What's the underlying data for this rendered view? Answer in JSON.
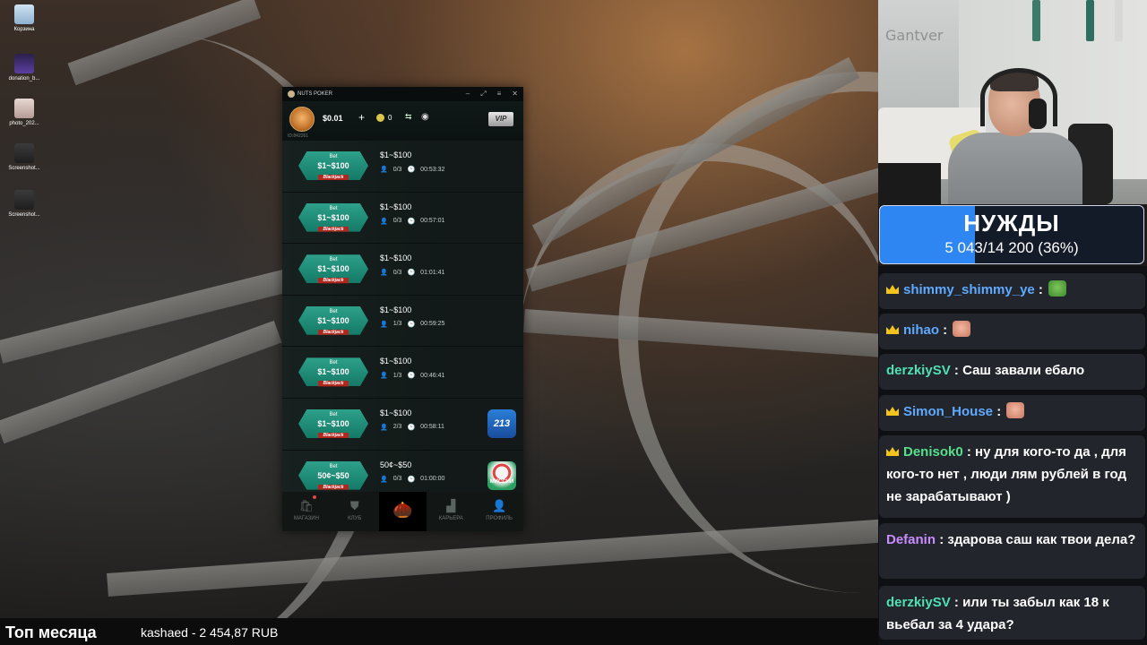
{
  "desktop": {
    "icons": [
      {
        "label": "Корзина",
        "icon": "trash-icon"
      },
      {
        "label": "donation_b...",
        "icon": "file-icon"
      },
      {
        "label": "photo_202...",
        "icon": "image-icon"
      },
      {
        "label": "Screenshot...",
        "icon": "image-icon"
      },
      {
        "label": "Screenshot...",
        "icon": "image-icon"
      }
    ]
  },
  "poker": {
    "title": "NUTS POKER",
    "balance": "$0.01",
    "coins": "0",
    "player_id": "ID:842261",
    "vip_label": "VIP",
    "tables": [
      {
        "bet": "Bet",
        "range": "$1~$100",
        "game": "Blackjack",
        "stakes": "$1~$100",
        "players": "0/3",
        "time": "00:53:32",
        "badge": ""
      },
      {
        "bet": "Bet",
        "range": "$1~$100",
        "game": "Blackjack",
        "stakes": "$1~$100",
        "players": "0/3",
        "time": "00:57:01",
        "badge": ""
      },
      {
        "bet": "Bet",
        "range": "$1~$100",
        "game": "Blackjack",
        "stakes": "$1~$100",
        "players": "0/3",
        "time": "01:01:41",
        "badge": ""
      },
      {
        "bet": "Bet",
        "range": "$1~$100",
        "game": "Blackjack",
        "stakes": "$1~$100",
        "players": "1/3",
        "time": "00:59:25",
        "badge": ""
      },
      {
        "bet": "Bet",
        "range": "$1~$100",
        "game": "Blackjack",
        "stakes": "$1~$100",
        "players": "1/3",
        "time": "00:46:41",
        "badge": ""
      },
      {
        "bet": "Bet",
        "range": "$1~$100",
        "game": "Blackjack",
        "stakes": "$1~$100",
        "players": "2/3",
        "time": "00:58:11",
        "badge": "213"
      },
      {
        "bet": "Bet",
        "range": "50¢~$50",
        "game": "Blackjack",
        "stakes": "50¢~$50",
        "players": "0/3",
        "time": "01:00:00",
        "badge": "МИССИИ"
      }
    ],
    "nav": [
      {
        "label": "МАГАЗИН",
        "icon": "shop-icon"
      },
      {
        "label": "КЛУБ",
        "icon": "club-icon"
      },
      {
        "label": "",
        "icon": "acorn-icon"
      },
      {
        "label": "КАРЬЕРА",
        "icon": "career-icon"
      },
      {
        "label": "ПРОФИЛЬ",
        "icon": "profile-icon"
      }
    ]
  },
  "webcam": {
    "wall_text": "Gantver"
  },
  "goal": {
    "title": "НУЖДЫ",
    "progress_text": "5 043/14 200 (36%)",
    "fraction": 0.36
  },
  "chat": [
    {
      "user": "shimmy_shimmy_ye",
      "text": "",
      "sep": ":",
      "crown": true,
      "emote": "pepe",
      "color": "#5fa9ff"
    },
    {
      "user": "nihao",
      "text": "",
      "sep": ":",
      "crown": true,
      "emote": "face",
      "color": "#5fa9ff"
    },
    {
      "user": "derzkiySV",
      "text": "Саш завали ебало",
      "sep": ":",
      "crown": false,
      "emote": "",
      "color": "#4fe0b4"
    },
    {
      "user": "Simon_House",
      "text": "",
      "sep": ":",
      "crown": true,
      "emote": "face",
      "color": "#5fa9ff"
    },
    {
      "user": "Denisok0",
      "text": "ну для кого-то да , для кого-то нет , люди лям рублей в год не зарабатывают )",
      "sep": ":",
      "crown": true,
      "emote": "",
      "color": "#56e08b"
    },
    {
      "user": "Defanin",
      "text": "здарова саш как твои дела?",
      "sep": ":",
      "crown": false,
      "emote": "",
      "color": "#c98cff"
    },
    {
      "user": "derzkiySV",
      "text": "или ты забыл как 18 к вьебал за 4 удара?",
      "sep": ":",
      "crown": false,
      "emote": "",
      "color": "#4fe0b4"
    }
  ],
  "bottom": {
    "label": "Топ месяца",
    "donation": "kashaed - 2 454,87 RUB"
  }
}
